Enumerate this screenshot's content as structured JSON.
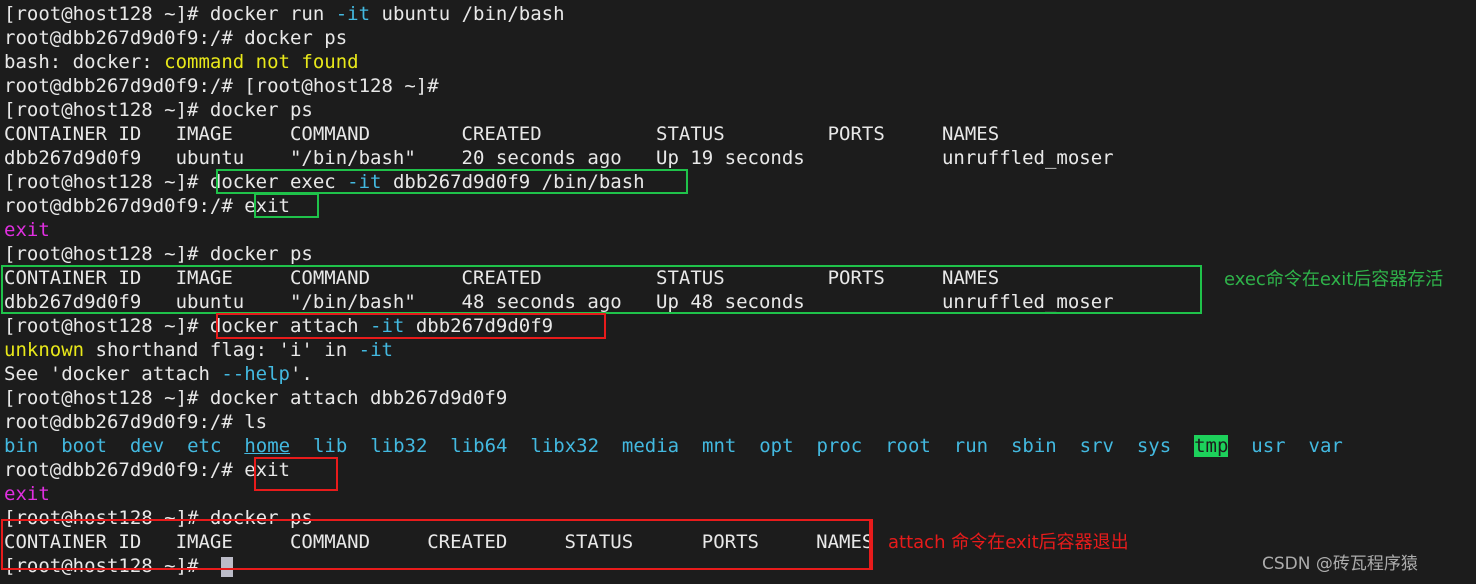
{
  "terminal": {
    "background": "#1c1c1c",
    "foreground": "#e8e8e8",
    "prompt_host": "[root@host128 ~]# ",
    "prompt_container": "root@dbb267d9d0f9:/# ",
    "colors": {
      "cyan": "#43b9e0",
      "yellow": "#e8e81a",
      "magenta": "#e02fe0",
      "green_box": "#1fc24a",
      "red_box": "#e81b1b",
      "tmp_highlight_bg": "#1dd15b"
    },
    "lines": [
      {
        "id": "l1",
        "segments": [
          {
            "text": "[root@host128 ~]# docker run ",
            "color": "default"
          },
          {
            "text": "-it",
            "color": "cyan"
          },
          {
            "text": " ubuntu /bin/bash",
            "color": "default"
          }
        ]
      },
      {
        "id": "l2",
        "segments": [
          {
            "text": "root@dbb267d9d0f9:/# docker ps",
            "color": "default"
          }
        ]
      },
      {
        "id": "l3",
        "segments": [
          {
            "text": "bash: docker: ",
            "color": "default"
          },
          {
            "text": "command not found",
            "color": "yellow"
          }
        ]
      },
      {
        "id": "l4",
        "segments": [
          {
            "text": "root@dbb267d9d0f9:/# [root@host128 ~]#",
            "color": "default"
          }
        ]
      },
      {
        "id": "l5",
        "segments": [
          {
            "text": "[root@host128 ~]# docker ps",
            "color": "default"
          }
        ]
      },
      {
        "id": "l6",
        "segments": [
          {
            "text": "CONTAINER ID   IMAGE     COMMAND        CREATED          STATUS         PORTS     NAMES",
            "color": "default"
          }
        ]
      },
      {
        "id": "l7",
        "segments": [
          {
            "text": "dbb267d9d0f9   ubuntu    \"/bin/bash\"    20 seconds ago   Up 19 seconds            unruffled_moser",
            "color": "default"
          }
        ]
      },
      {
        "id": "l8",
        "segments": [
          {
            "text": "[root@host128 ~]# docker exec ",
            "color": "default"
          },
          {
            "text": "-it",
            "color": "cyan"
          },
          {
            "text": " dbb267d9d0f9 /bin/bash",
            "color": "default"
          }
        ]
      },
      {
        "id": "l9",
        "segments": [
          {
            "text": "root@dbb267d9d0f9:/# exit",
            "color": "default"
          }
        ]
      },
      {
        "id": "l10",
        "segments": [
          {
            "text": "exit",
            "color": "magenta"
          }
        ]
      },
      {
        "id": "l11",
        "segments": [
          {
            "text": "[root@host128 ~]# docker ps",
            "color": "default"
          }
        ]
      },
      {
        "id": "l12",
        "segments": [
          {
            "text": "CONTAINER ID   IMAGE     COMMAND        CREATED          STATUS         PORTS     NAMES",
            "color": "default"
          }
        ]
      },
      {
        "id": "l13",
        "segments": [
          {
            "text": "dbb267d9d0f9   ubuntu    \"/bin/bash\"    48 seconds ago   Up 48 seconds            unruffled_moser",
            "color": "default"
          }
        ]
      },
      {
        "id": "l14",
        "segments": [
          {
            "text": "[root@host128 ~]# docker attach ",
            "color": "default"
          },
          {
            "text": "-it",
            "color": "cyan"
          },
          {
            "text": " dbb267d9d0f9",
            "color": "default"
          }
        ]
      },
      {
        "id": "l15",
        "segments": [
          {
            "text": "unknown",
            "color": "yellow"
          },
          {
            "text": " shorthand flag: 'i' in ",
            "color": "default"
          },
          {
            "text": "-it",
            "color": "cyan"
          }
        ]
      },
      {
        "id": "l16",
        "segments": [
          {
            "text": "See 'docker attach ",
            "color": "default"
          },
          {
            "text": "--help",
            "color": "cyan"
          },
          {
            "text": "'.",
            "color": "default"
          }
        ]
      },
      {
        "id": "l17",
        "segments": [
          {
            "text": "[root@host128 ~]# docker attach dbb267d9d0f9",
            "color": "default"
          }
        ]
      },
      {
        "id": "l18",
        "segments": [
          {
            "text": "root@dbb267d9d0f9:/# ls",
            "color": "default"
          }
        ]
      },
      {
        "id": "l19",
        "ls_listing": true,
        "entries": [
          {
            "name": "bin",
            "style": "dir"
          },
          {
            "name": "boot",
            "style": "dir"
          },
          {
            "name": "dev",
            "style": "dir"
          },
          {
            "name": "etc",
            "style": "dir"
          },
          {
            "name": "home",
            "style": "dir"
          },
          {
            "name": "lib",
            "style": "dir"
          },
          {
            "name": "lib32",
            "style": "dir"
          },
          {
            "name": "lib64",
            "style": "dir"
          },
          {
            "name": "libx32",
            "style": "dir"
          },
          {
            "name": "media",
            "style": "dir"
          },
          {
            "name": "mnt",
            "style": "dir"
          },
          {
            "name": "opt",
            "style": "dir"
          },
          {
            "name": "proc",
            "style": "dir"
          },
          {
            "name": "root",
            "style": "dir"
          },
          {
            "name": "run",
            "style": "dir"
          },
          {
            "name": "sbin",
            "style": "dir"
          },
          {
            "name": "srv",
            "style": "dir"
          },
          {
            "name": "sys",
            "style": "dir"
          },
          {
            "name": "tmp",
            "style": "sticky"
          },
          {
            "name": "usr",
            "style": "dir"
          },
          {
            "name": "var",
            "style": "dir"
          }
        ]
      },
      {
        "id": "l20",
        "segments": [
          {
            "text": "root@dbb267d9d0f9:/# exit",
            "color": "default"
          }
        ]
      },
      {
        "id": "l21",
        "segments": [
          {
            "text": "exit",
            "color": "magenta"
          }
        ]
      },
      {
        "id": "l22",
        "segments": [
          {
            "text": "[root@host128 ~]# docker ps",
            "color": "default"
          }
        ]
      },
      {
        "id": "l23",
        "segments": [
          {
            "text": "CONTAINER ID   IMAGE     COMMAND     CREATED     STATUS      PORTS     NAMES",
            "color": "default"
          }
        ]
      },
      {
        "id": "l24",
        "segments": [
          {
            "text": "[root@host128 ~]# ",
            "color": "default"
          }
        ]
      }
    ]
  },
  "annotations": {
    "exec_note": "exec命令在exit后容器存活",
    "attach_note": "attach 命令在exit后容器退出"
  },
  "watermark": {
    "text": "CSDN @砖瓦程序猿"
  }
}
